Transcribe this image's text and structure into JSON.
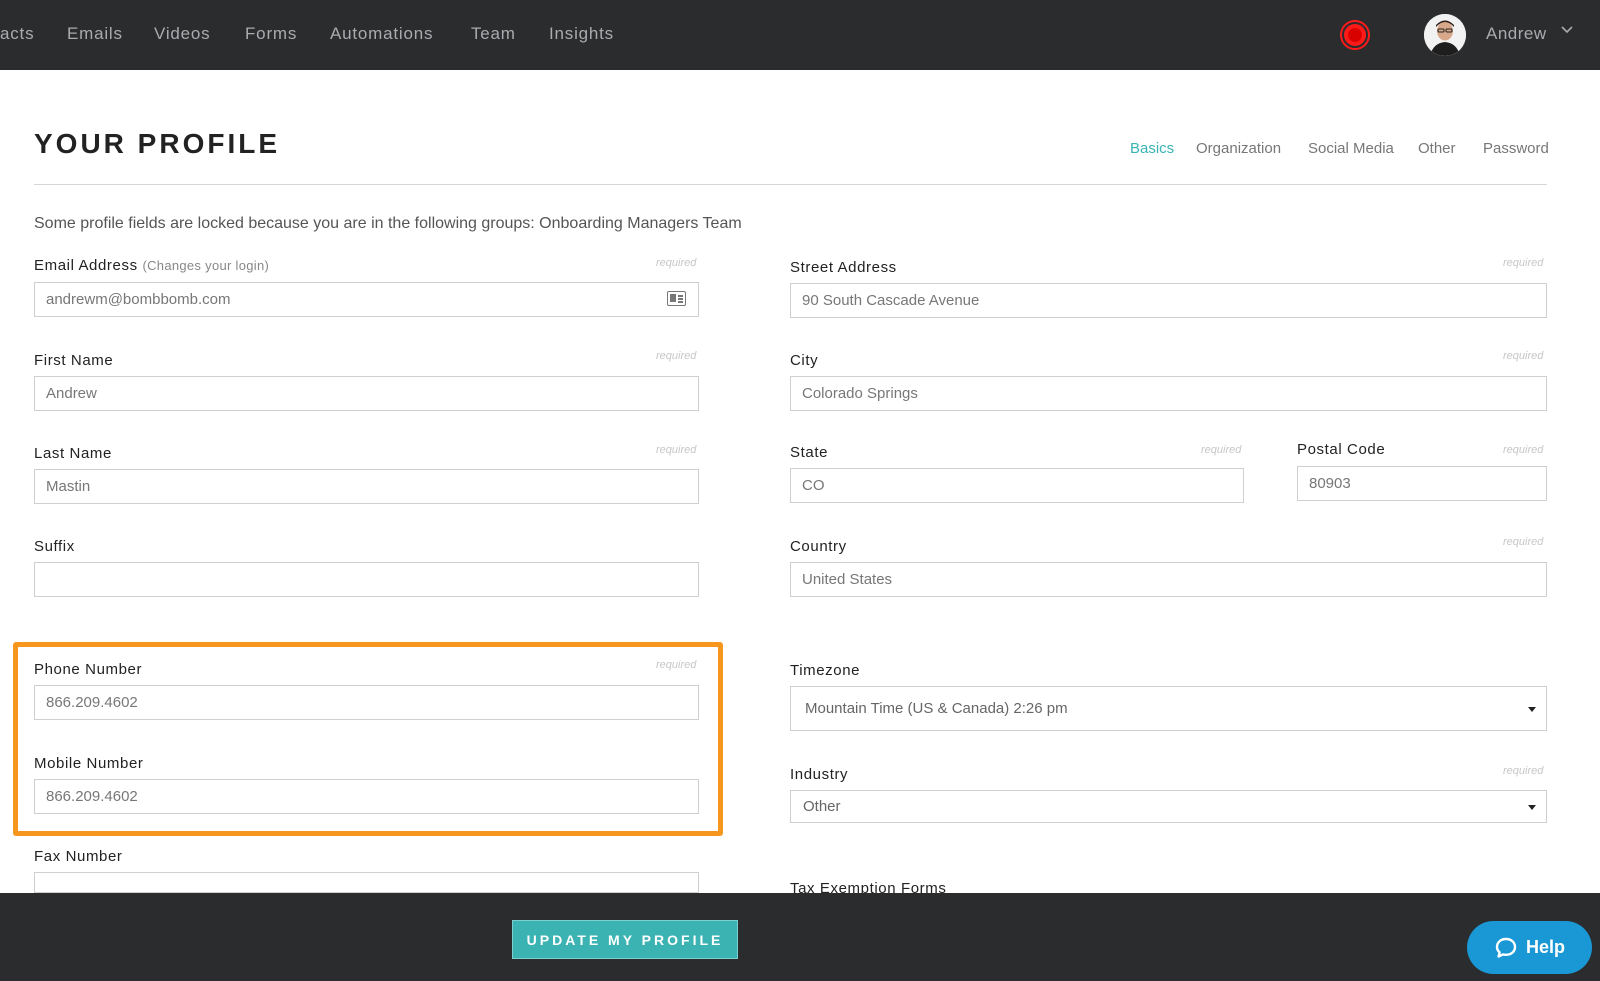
{
  "nav": {
    "items": [
      "acts",
      "Emails",
      "Videos",
      "Forms",
      "Automations",
      "Team",
      "Insights"
    ],
    "user_name": "Andrew"
  },
  "page": {
    "title": "YOUR PROFILE",
    "tabs": [
      "Basics",
      "Organization",
      "Social Media",
      "Other",
      "Password"
    ],
    "active_tab": "Basics",
    "notice": "Some profile fields are locked because you are in the following groups: Onboarding Managers Team",
    "required_text": "required"
  },
  "fields": {
    "email": {
      "label": "Email Address",
      "sub": "(Changes your login)",
      "value": "andrewm@bombbomb.com"
    },
    "first_name": {
      "label": "First Name",
      "value": "Andrew"
    },
    "last_name": {
      "label": "Last Name",
      "value": "Mastin"
    },
    "suffix": {
      "label": "Suffix",
      "value": ""
    },
    "phone": {
      "label": "Phone Number",
      "value": "866.209.4602"
    },
    "mobile": {
      "label": "Mobile Number",
      "value": "866.209.4602"
    },
    "fax": {
      "label": "Fax Number",
      "value": ""
    },
    "street": {
      "label": "Street Address",
      "value": "90 South Cascade Avenue"
    },
    "city": {
      "label": "City",
      "value": "Colorado Springs"
    },
    "state": {
      "label": "State",
      "value": "CO"
    },
    "postal": {
      "label": "Postal Code",
      "value": "80903"
    },
    "country": {
      "label": "Country",
      "value": "United States"
    },
    "timezone": {
      "label": "Timezone",
      "value": "Mountain Time (US & Canada) 2:26 pm"
    },
    "industry": {
      "label": "Industry",
      "value": "Other"
    },
    "tax": {
      "label": "Tax Exemption Forms"
    }
  },
  "footer": {
    "update_label": "UPDATE MY PROFILE",
    "help_label": "Help"
  },
  "colors": {
    "nav_bg": "#2b2c2e",
    "accent": "#3bb3b3",
    "highlight": "#f7961c",
    "help": "#1a97d5",
    "record": "#ff1a1a"
  }
}
